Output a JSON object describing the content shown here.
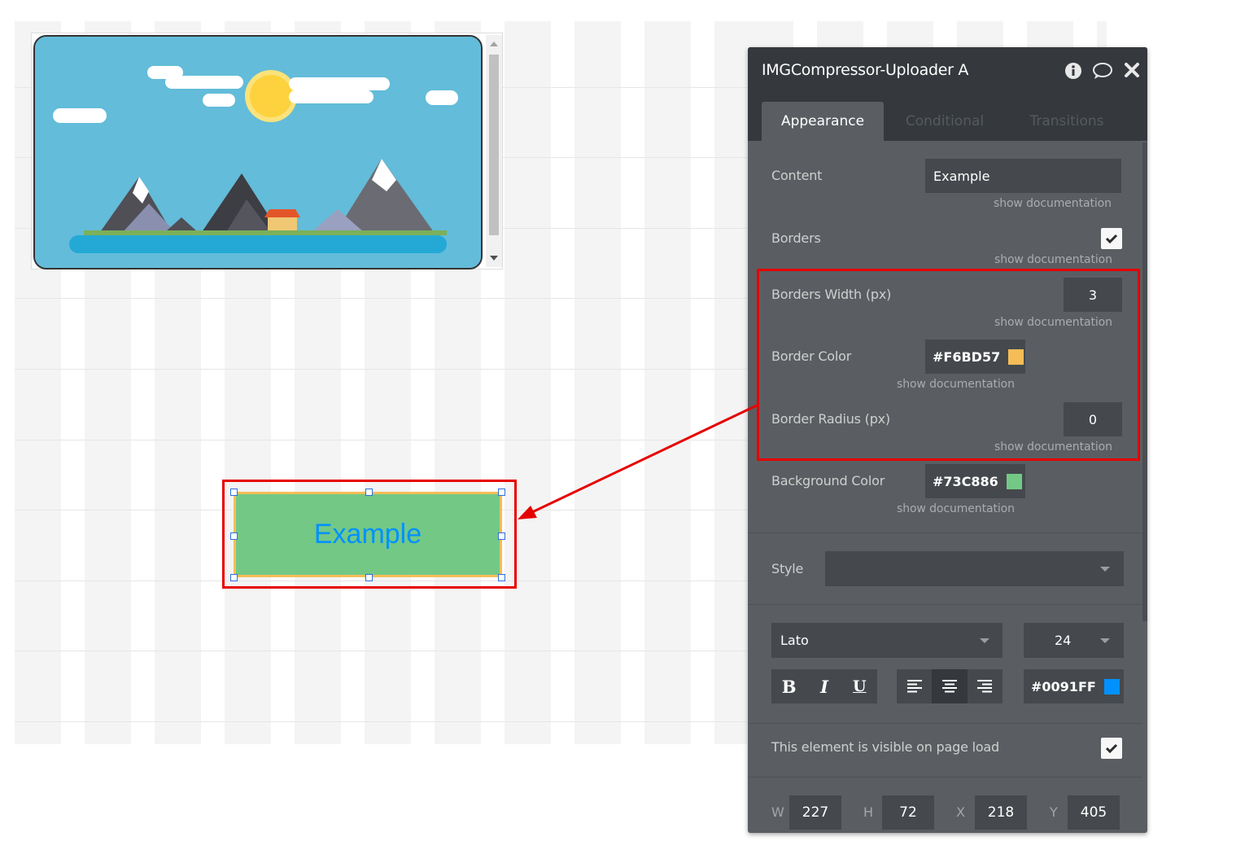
{
  "canvas": {
    "image_description_note": "",
    "button": {
      "text": "Example",
      "background": "#73C886",
      "border": "#F6BD57",
      "text_color": "#0091FF"
    }
  },
  "panel": {
    "title": "IMGCompressor-Uploader A",
    "header_icons": [
      "info-icon",
      "comment-icon",
      "close-icon"
    ],
    "tabs": [
      {
        "label": "Appearance",
        "active": true
      },
      {
        "label": "Conditional",
        "active": false
      },
      {
        "label": "Transitions",
        "active": false
      }
    ],
    "doc_link": "show documentation",
    "content": {
      "label": "Content",
      "value": "Example"
    },
    "borders": {
      "label": "Borders",
      "checked": true
    },
    "border_width": {
      "label": "Borders Width (px)",
      "value": "3"
    },
    "border_color": {
      "label": "Border Color",
      "value": "#F6BD57"
    },
    "border_radius": {
      "label": "Border Radius (px)",
      "value": "0"
    },
    "background_color": {
      "label": "Background Color",
      "value": "#73C886"
    },
    "style": {
      "label": "Style",
      "value": ""
    },
    "font": {
      "family": "Lato",
      "size": "24"
    },
    "format": {
      "bold": "B",
      "italic": "I",
      "underline": "U",
      "align_selected": "center"
    },
    "font_color": {
      "value": "#0091FF"
    },
    "visible_on_load": {
      "label": "This element is visible on page load",
      "checked": true
    },
    "dimensions": {
      "w_label": "W",
      "w": "227",
      "h_label": "H",
      "h": "72",
      "x_label": "X",
      "x": "218",
      "y_label": "Y",
      "y": "405"
    }
  },
  "colors": {
    "panel_bg": "#5a5e62",
    "header_bg": "#35393d",
    "highlight": "#e60000"
  }
}
